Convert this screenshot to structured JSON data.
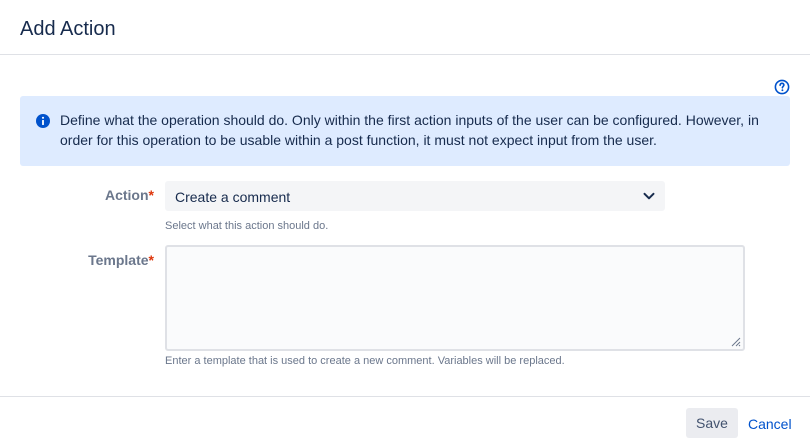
{
  "dialog": {
    "title": "Add Action"
  },
  "info": {
    "message": "Define what the operation should do. Only within the first action inputs of the user can be configured. However, in order for this operation to be usable within a post function, it must not expect input from the user."
  },
  "form": {
    "action": {
      "label": "Action",
      "required_mark": "*",
      "selected_value": "Create a comment",
      "help_text": "Select what this action should do."
    },
    "template": {
      "label": "Template",
      "required_mark": "*",
      "value": "",
      "help_text": "Enter a template that is used to create a new comment. Variables will be replaced."
    }
  },
  "footer": {
    "save_label": "Save",
    "cancel_label": "Cancel"
  },
  "colors": {
    "info_background": "#deebff",
    "info_icon": "#0052cc",
    "required": "#de350b",
    "link": "#0052cc"
  },
  "icons": {
    "help": "question-circle-icon",
    "info": "info-circle-icon",
    "dropdown": "chevron-down-icon",
    "resize": "resize-grip-icon"
  }
}
